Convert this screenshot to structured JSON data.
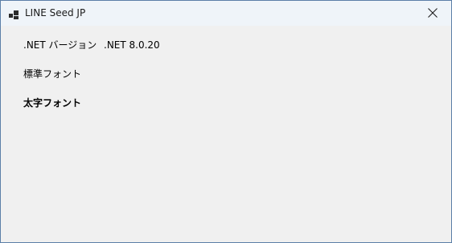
{
  "window": {
    "title": "LINE Seed JP",
    "icon": "app-window-icon",
    "close_icon": "close-icon"
  },
  "content": {
    "net_version_label": ".NET バージョン",
    "net_version_value": ".NET 8.0.20",
    "regular_font_label": "標準フォント",
    "bold_font_label": "太字フォント"
  },
  "colors": {
    "title_bar": "#eff4f9",
    "client_background": "#f0f0f0",
    "window_border": "#5c7fa8"
  }
}
